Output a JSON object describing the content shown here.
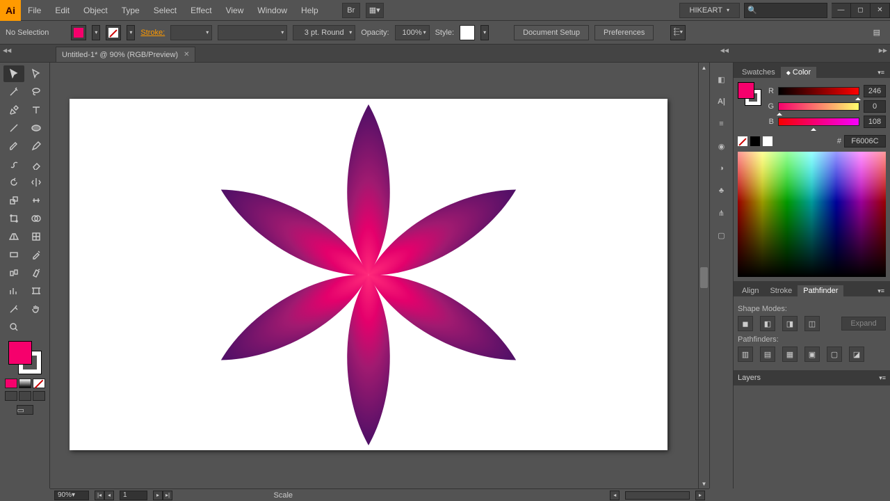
{
  "app": {
    "icon_text": "Ai"
  },
  "menus": [
    "File",
    "Edit",
    "Object",
    "Type",
    "Select",
    "Effect",
    "View",
    "Window",
    "Help"
  ],
  "user": "HIKEART",
  "search_placeholder": "",
  "control": {
    "selection_label": "No Selection",
    "stroke_label": "Stroke:",
    "stroke_weight": "",
    "brush_label": "3 pt. Round",
    "opacity_label": "Opacity:",
    "opacity_value": "100%",
    "style_label": "Style:",
    "doc_setup": "Document Setup",
    "preferences": "Preferences"
  },
  "document": {
    "tab_title": "Untitled-1* @ 90% (RGB/Preview)"
  },
  "panels": {
    "swatches_tab": "Swatches",
    "color_tab": "Color",
    "r_label": "R",
    "r_value": "246",
    "g_label": "G",
    "g_value": "0",
    "b_label": "B",
    "b_value": "108",
    "hash": "#",
    "hex_value": "F6006C",
    "align_tab": "Align",
    "stroke_tab": "Stroke",
    "pathfinder_tab": "Pathfinder",
    "shape_modes": "Shape Modes:",
    "expand_button": "Expand",
    "pathfinders_label": "Pathfinders:",
    "layers_tab": "Layers"
  },
  "status": {
    "zoom": "90%",
    "page_current": "1",
    "scale_label": "Scale"
  },
  "colors": {
    "accent": "#f6006c",
    "petal_outer": "#5a1573",
    "petal_mid": "#8e1a6b",
    "petal_inner": "#d6006c",
    "petal_core": "#ff2a7a"
  }
}
